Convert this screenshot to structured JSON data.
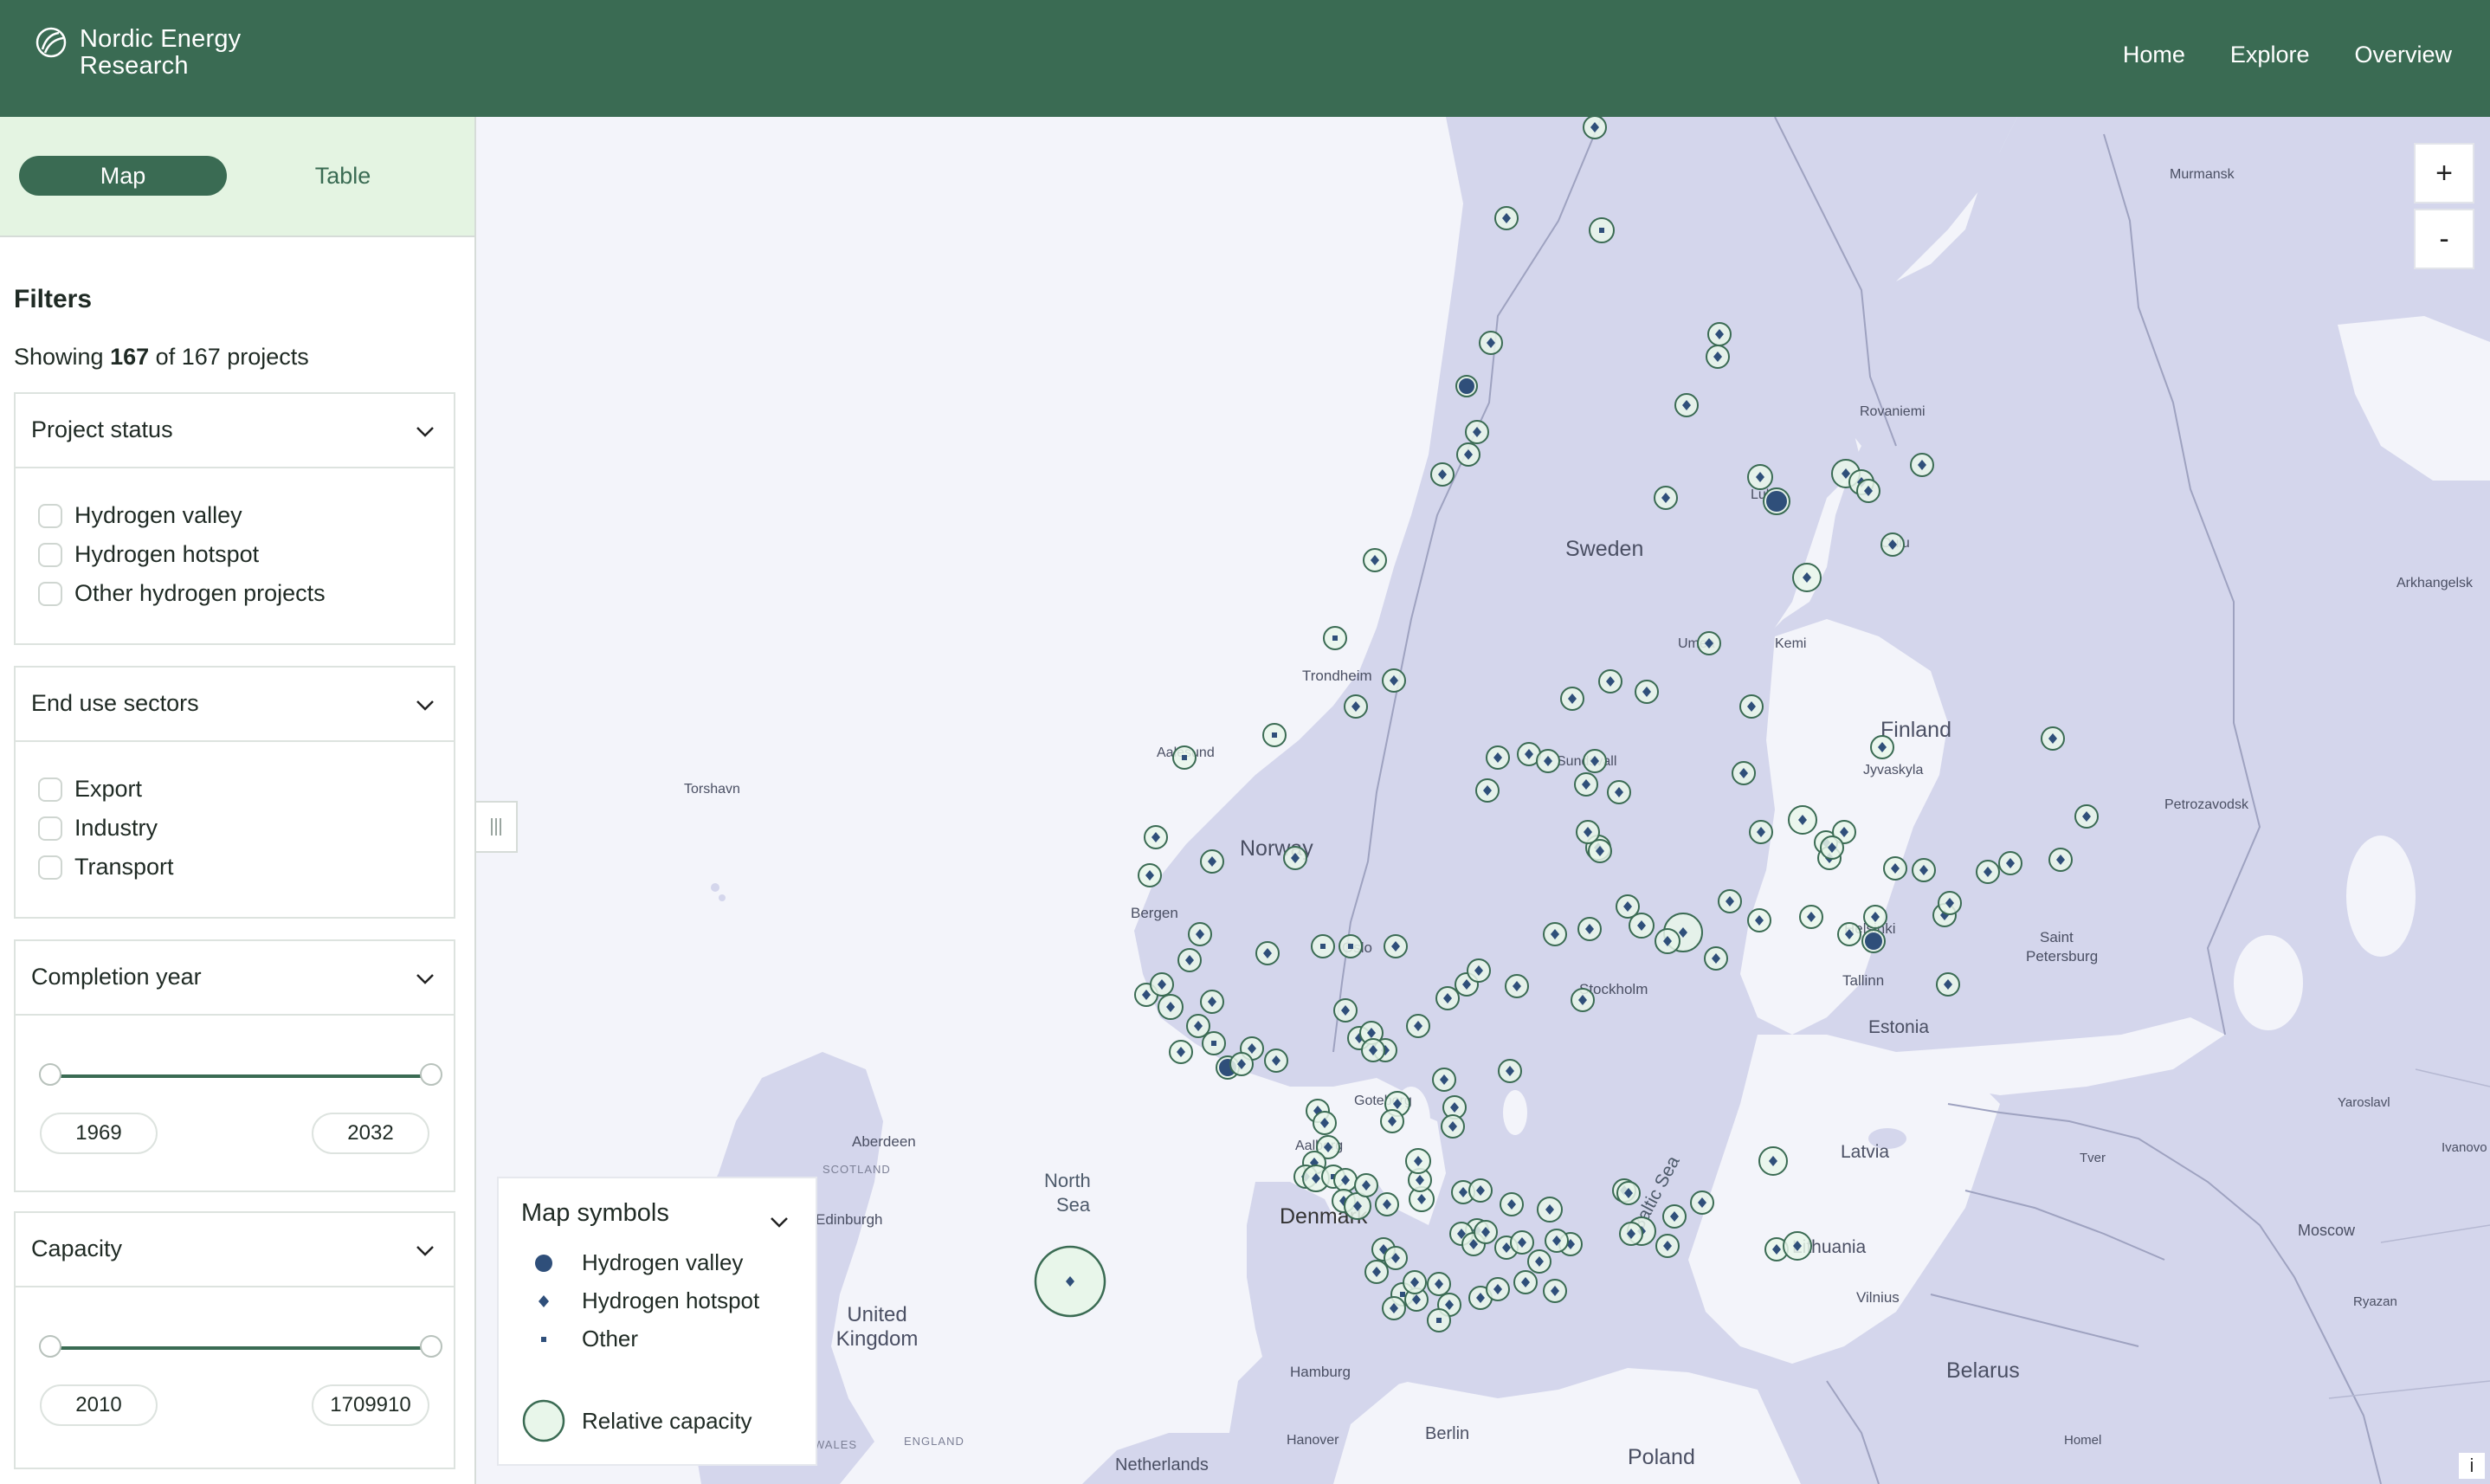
{
  "header": {
    "brand_line1": "Nordic Energy",
    "brand_line2": "Research",
    "nav": [
      "Home",
      "Explore",
      "Overview"
    ],
    "color": "#3a6b53"
  },
  "view_tabs": {
    "active": "Map",
    "other": "Table"
  },
  "filters": {
    "title": "Filters",
    "showing_prefix": "Showing",
    "shown": "167",
    "of": "of 167 projects",
    "project_status": {
      "title": "Project status",
      "options": [
        "Hydrogen valley",
        "Hydrogen hotspot",
        "Other hydrogen projects"
      ]
    },
    "end_use": {
      "title": "End use sectors",
      "options": [
        "Export",
        "Industry",
        "Transport"
      ]
    },
    "completion_year": {
      "title": "Completion year",
      "min": "1969",
      "max": "2032"
    },
    "capacity": {
      "title": "Capacity",
      "min": "2010",
      "max": "1709910"
    }
  },
  "map": {
    "zoom_in": "+",
    "zoom_out": "-",
    "info": "i",
    "legend": {
      "title": "Map symbols",
      "valley": "Hydrogen valley",
      "hotspot": "Hydrogen hotspot",
      "other": "Other",
      "capacity": "Relative capacity"
    },
    "countries": [
      "Sweden",
      "Norway",
      "Finland",
      "Estonia",
      "Latvia",
      "Lithuania",
      "Belarus",
      "Poland",
      "Denmark",
      "United Kingdom"
    ],
    "seas": {
      "north_sea_1": "North",
      "north_sea_2": "Sea",
      "baltic": "Baltic Sea"
    },
    "cities": [
      "Trondheim",
      "Bergen",
      "Oslo",
      "Stockholm",
      "Helsinki",
      "Tallinn",
      "Saint",
      "Petersburg",
      "Petrozavodsk",
      "Jyvaskyla",
      "Rovaniemi",
      "Murmansk",
      "Arkhangelsk",
      "Aberdeen",
      "Edinburgh",
      "Hamburg",
      "Hanover",
      "Berlin",
      "Netherlands",
      "Moscow",
      "Tver",
      "Yaroslavl",
      "Ivanovo",
      "Ryazan",
      "Vilnius",
      "Torshavn",
      "Aalesund",
      "Sundsvall",
      "Umea",
      "Lulea",
      "Kemi",
      "Oulu",
      "Goteborg",
      "Aalborg",
      "Homel",
      "ENGLAND",
      "SCOTLAND",
      "WALES"
    ],
    "colors": {
      "land": "#d4d6ec",
      "water": "#f3f4fa",
      "marker_ring": "#3a6b53",
      "marker_fill": "#e8f6ea",
      "valley": "#2f4f7a"
    }
  }
}
